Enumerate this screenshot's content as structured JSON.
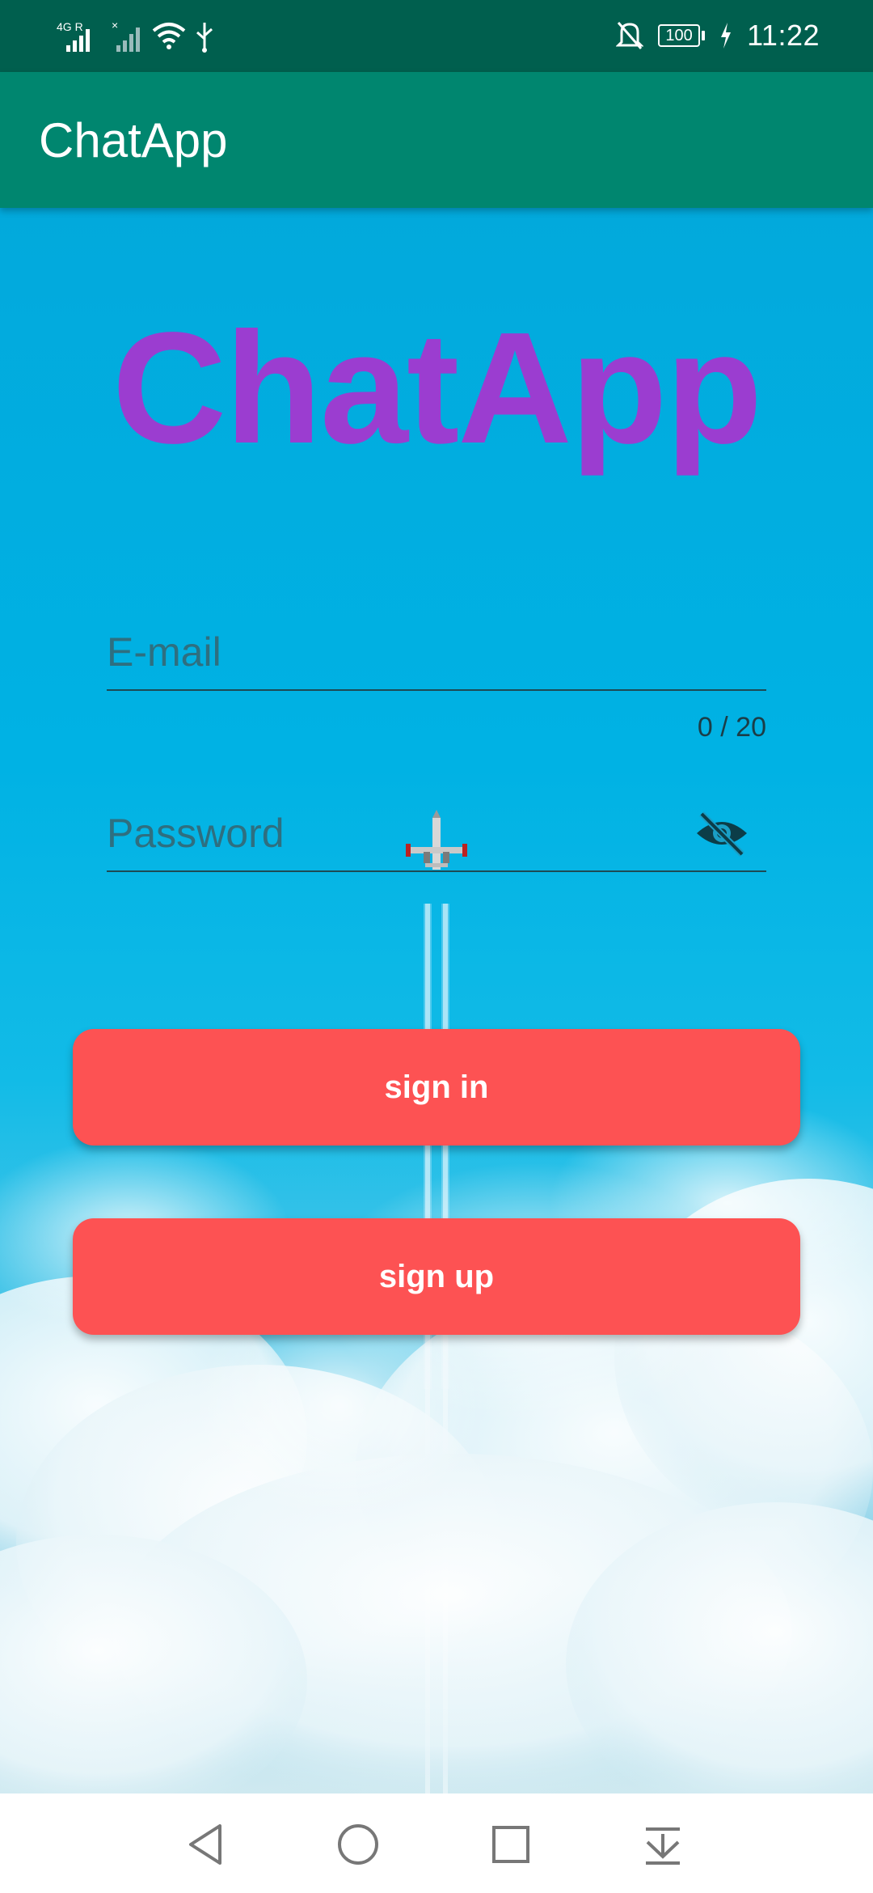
{
  "status_bar": {
    "network_label": "4G R",
    "battery_level": "100",
    "time": "11:22",
    "icons": [
      "signal-icon",
      "signal-off-icon",
      "wifi-icon",
      "usb-icon",
      "notifications-off-icon",
      "battery-icon",
      "charging-icon"
    ]
  },
  "app_bar": {
    "title": "ChatApp"
  },
  "logo": {
    "text": "ChatApp",
    "color": "#9b3dd0"
  },
  "form": {
    "email": {
      "placeholder": "E-mail",
      "value": "",
      "counter": "0 / 20"
    },
    "password": {
      "placeholder": "Password",
      "value": "",
      "toggle_icon": "eye-off-icon"
    },
    "sign_in_label": "sign in",
    "sign_up_label": "sign up"
  },
  "nav_bar": {
    "buttons": [
      "back-icon",
      "home-icon",
      "recents-icon",
      "notification-drawer-icon"
    ]
  },
  "colors": {
    "status_bar": "#005f4e",
    "app_bar": "#00866f",
    "button": "#fd5253",
    "sky": "#00a6d9"
  }
}
